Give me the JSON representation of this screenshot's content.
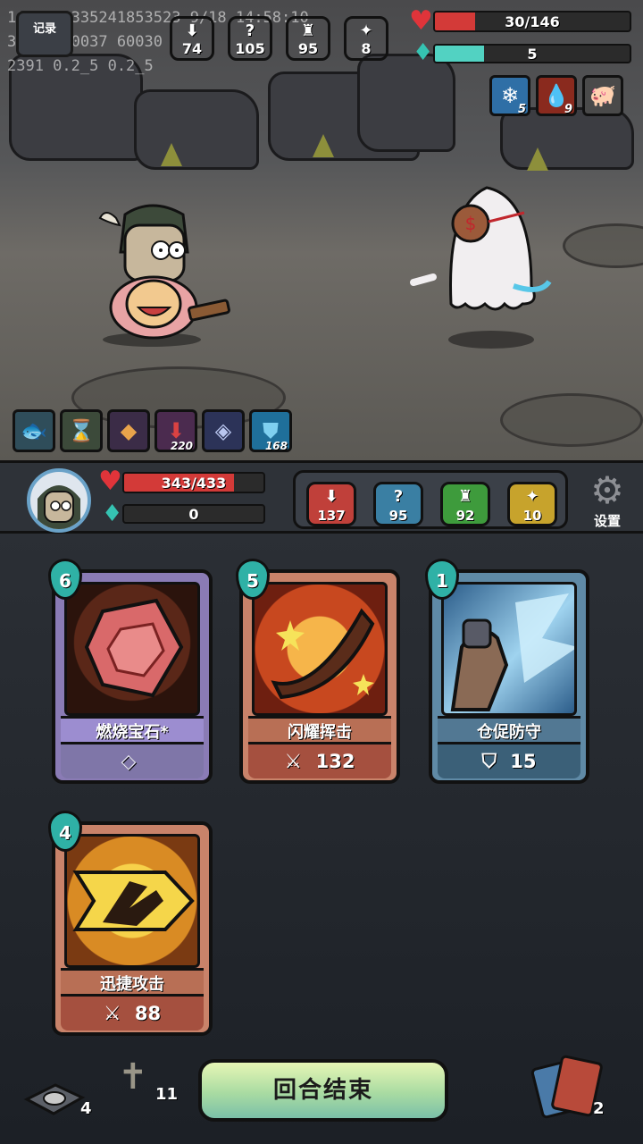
{
  "debug_lines": [
    "1624714335241853523 9/18 14:58:10",
    "30020 50037 60030",
    "2391 0.2_5 0.2_5"
  ],
  "log_button": {
    "label": "记录"
  },
  "enemy": {
    "hp_text": "30/146",
    "hp_fraction": 0.205,
    "energy_text": "5",
    "energy_fraction": 0.25,
    "stats": [
      {
        "name": "attack",
        "value": "74",
        "color": "#c0403a",
        "glyph": "⬇"
      },
      {
        "name": "mystery",
        "value": "105",
        "color": "#3a7fa3",
        "glyph": "?"
      },
      {
        "name": "defense",
        "value": "95",
        "color": "#3e9b3c",
        "glyph": "♜"
      },
      {
        "name": "luck",
        "value": "8",
        "color": "#c7a32c",
        "glyph": "✦"
      }
    ],
    "statuses": [
      {
        "name": "frost",
        "count": "5",
        "icon": "❄",
        "color": "#2f6fa6"
      },
      {
        "name": "bleed",
        "count": "9",
        "icon": "💧",
        "color": "#8a2a1e"
      },
      {
        "name": "intent-pig",
        "count": "",
        "icon": "🐖",
        "color": "#4a4a4a"
      }
    ]
  },
  "player_buffs": [
    {
      "name": "fish",
      "count": "",
      "icon": "🐟",
      "color": "#2f4d5a"
    },
    {
      "name": "hourglass",
      "count": "",
      "icon": "⌛",
      "color": "#3c4a3a"
    },
    {
      "name": "gem",
      "count": "",
      "icon": "◆",
      "color": "#3b2c47"
    },
    {
      "name": "attack-down",
      "count": "220",
      "icon": "⬇",
      "color": "#4b2b4f"
    },
    {
      "name": "crystal",
      "count": "",
      "icon": "◈",
      "color": "#2c3358"
    },
    {
      "name": "shield",
      "count": "168",
      "icon": "⛊",
      "color": "#1f6f9a"
    }
  ],
  "player": {
    "hp_text": "343/433",
    "hp_fraction": 0.79,
    "energy_text": "0",
    "energy_fraction": 0,
    "stats": [
      {
        "name": "attack",
        "value": "137",
        "color": "#c0403a",
        "glyph": "⬇"
      },
      {
        "name": "mystery",
        "value": "95",
        "color": "#3a7fa3",
        "glyph": "?"
      },
      {
        "name": "defense",
        "value": "92",
        "color": "#3e9b3c",
        "glyph": "♜"
      },
      {
        "name": "luck",
        "value": "10",
        "color": "#c7a32c",
        "glyph": "✦"
      }
    ],
    "settings_label": "设置"
  },
  "cards": [
    {
      "id": "burning-gem",
      "name": "燃烧宝石*",
      "cost": "6",
      "value": "",
      "value_icon": "◇",
      "theme": "c-purple"
    },
    {
      "id": "flash-strike",
      "name": "闪耀挥击",
      "cost": "5",
      "value": "132",
      "value_icon": "⚔",
      "theme": "c-red"
    },
    {
      "id": "hasty-defense",
      "name": "仓促防守",
      "cost": "1",
      "value": "15",
      "value_icon": "⛉",
      "theme": "c-blue"
    },
    {
      "id": "swift-attack",
      "name": "迅捷攻击",
      "cost": "4",
      "value": "88",
      "value_icon": "⚔",
      "theme": "c-red"
    }
  ],
  "draw_pile": {
    "count": "4"
  },
  "discard_pile": {
    "count": "11"
  },
  "exhaust_pile": {
    "count": "2"
  },
  "end_turn_label": "回合结束"
}
